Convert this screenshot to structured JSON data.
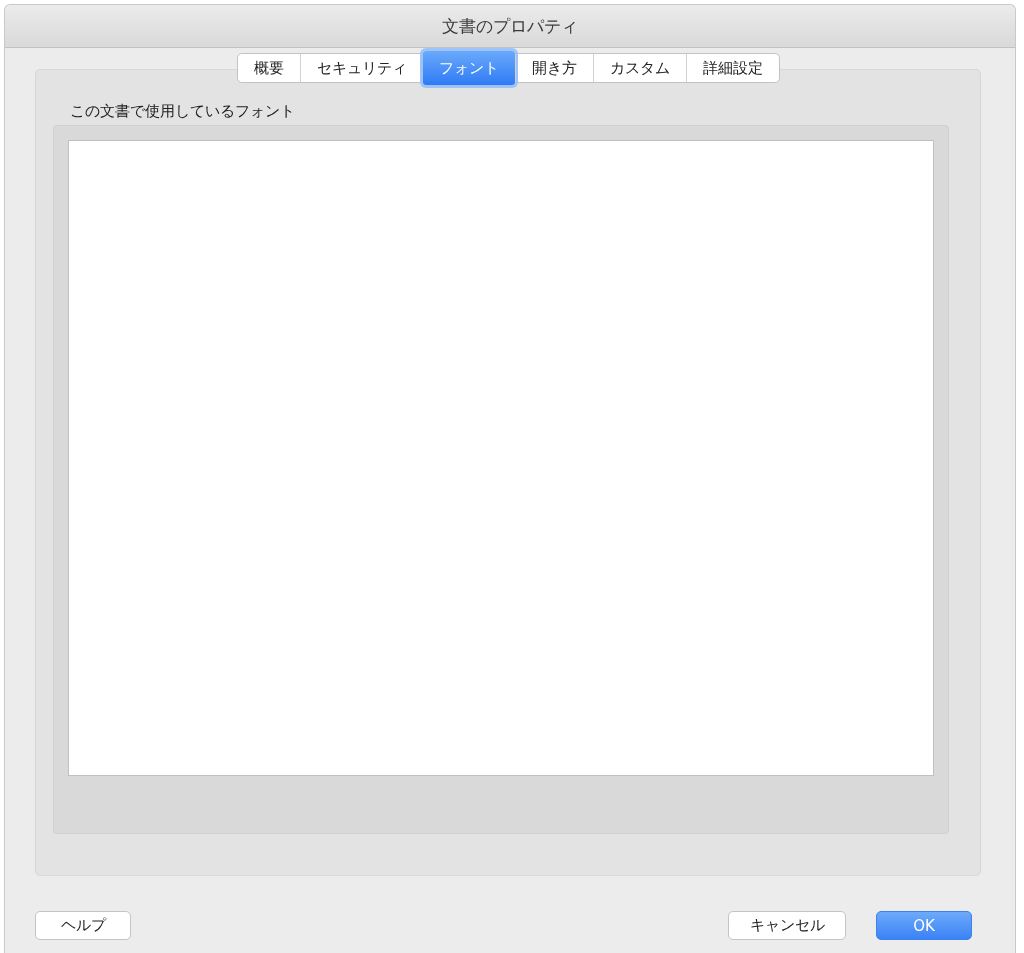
{
  "window": {
    "title": "文書のプロパティ"
  },
  "tabs": [
    {
      "label": "概要",
      "selected": false
    },
    {
      "label": "セキュリティ",
      "selected": false
    },
    {
      "label": "フォント",
      "selected": true
    },
    {
      "label": "開き方",
      "selected": false
    },
    {
      "label": "カスタム",
      "selected": false
    },
    {
      "label": "詳細設定",
      "selected": false
    }
  ],
  "fonts_group": {
    "label": "この文書で使用しているフォント"
  },
  "buttons": [
    {
      "label": "ヘルプ",
      "kind": "help"
    },
    {
      "label": "キャンセル",
      "kind": "normal"
    },
    {
      "label": "OK",
      "kind": "default"
    }
  ]
}
